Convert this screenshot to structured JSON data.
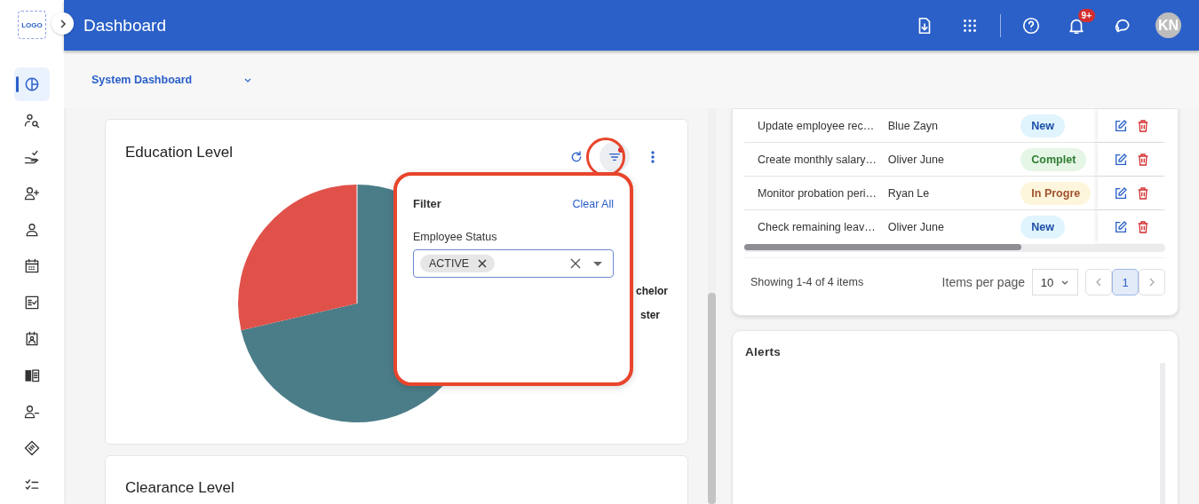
{
  "sidebar": {
    "logo": "LOGO",
    "items": [
      {
        "selected": true
      },
      {
        "selected": false
      },
      {
        "selected": false
      },
      {
        "selected": false
      },
      {
        "selected": false
      },
      {
        "selected": false
      },
      {
        "selected": false
      },
      {
        "selected": false
      },
      {
        "selected": false
      },
      {
        "selected": false
      },
      {
        "selected": false
      },
      {
        "selected": false
      }
    ]
  },
  "header": {
    "title": "Dashboard",
    "notification_count": "9+",
    "avatar_initials": "KN"
  },
  "subbar": {
    "dashboard_select": "System Dashboard"
  },
  "education_card": {
    "title": "Education Level",
    "filter_active": true,
    "legend": [
      {
        "label": "chelor"
      },
      {
        "label": "ster"
      }
    ],
    "filter_popup": {
      "title": "Filter",
      "clear_label": "Clear All",
      "fields": [
        {
          "label": "Employee Status",
          "chips": [
            "ACTIVE"
          ]
        }
      ]
    }
  },
  "clearance_card": {
    "title": "Clearance Level"
  },
  "tasks_table": {
    "rows": [
      {
        "task": "Update employee rec…",
        "assignee": "Blue Zayn",
        "status": {
          "text": "New",
          "kind": "new"
        }
      },
      {
        "task": "Create monthly salary…",
        "assignee": "Oliver June",
        "status": {
          "text": "Complet",
          "kind": "completed"
        }
      },
      {
        "task": "Monitor probation peri…",
        "assignee": "Ryan Le",
        "status": {
          "text": "In Progre",
          "kind": "in_progress"
        }
      },
      {
        "task": "Check remaining leav…",
        "assignee": "Oliver June",
        "status": {
          "text": "New",
          "kind": "new"
        }
      }
    ],
    "footer": {
      "summary": "Showing 1-4 of 4 items",
      "per_page_label": "Items per page",
      "per_page": "10",
      "pages": [
        {
          "label": "1",
          "selected": true
        }
      ]
    }
  },
  "alerts": {
    "title": "Alerts"
  }
}
